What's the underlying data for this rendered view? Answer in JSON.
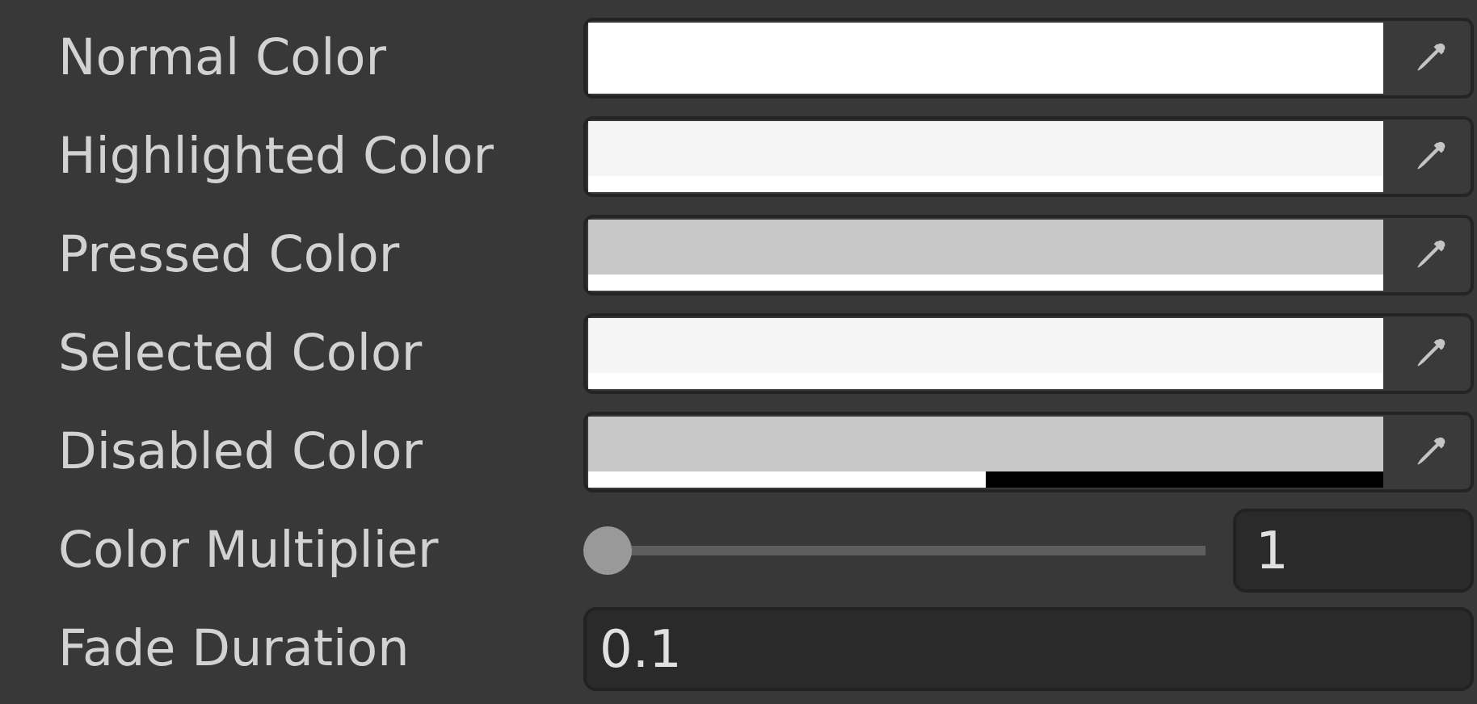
{
  "color_fields": [
    {
      "label": "Normal Color",
      "color": "#ffffff",
      "level": 1
    },
    {
      "label": "Highlighted Color",
      "color": "#f5f5f5",
      "level": 1
    },
    {
      "label": "Pressed Color",
      "color": "#c8c8c8",
      "level": 1
    },
    {
      "label": "Selected Color",
      "color": "#f5f5f5",
      "level": 1
    },
    {
      "label": "Disabled Color",
      "color": "#c8c8c8",
      "level": 0.5
    }
  ],
  "color_multiplier": {
    "label": "Color Multiplier",
    "level": 0,
    "value": "1"
  },
  "fade_duration": {
    "label": "Fade Duration",
    "value": "0.1"
  }
}
